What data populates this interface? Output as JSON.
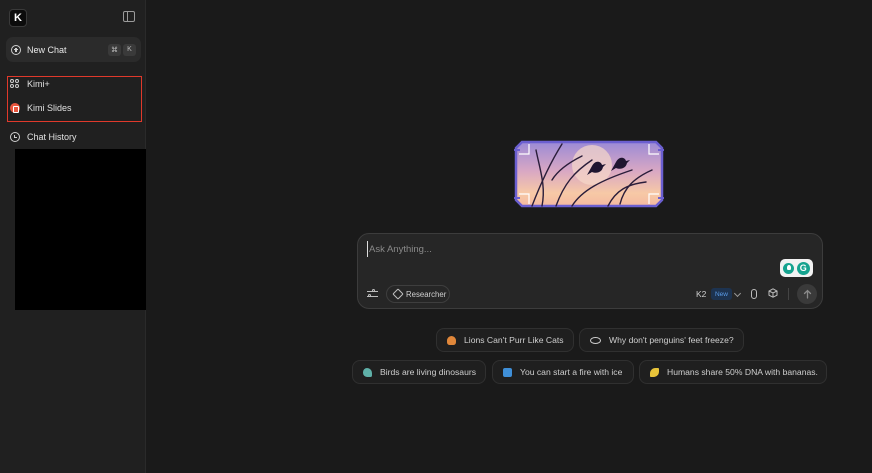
{
  "sidebar": {
    "logo_letter": "K",
    "new_chat": {
      "label": "New Chat",
      "shortcut": [
        "⌘",
        "K"
      ]
    },
    "items": [
      {
        "label": "Kimi+",
        "icon": "kimiplus-icon"
      },
      {
        "label": "Kimi Slides",
        "icon": "slides-icon"
      },
      {
        "label": "Chat History",
        "icon": "clock-icon"
      }
    ]
  },
  "chat": {
    "placeholder": "Ask Anything...",
    "grammarly_letter": "G",
    "researcher_label": "Researcher",
    "model": "K2",
    "model_badge": "New"
  },
  "suggestions": [
    {
      "label": "Lions Can't Purr Like Cats",
      "icon": "burger-emoji-icon"
    },
    {
      "label": "Why don't penguins' feet freeze?",
      "icon": "eye-emoji-icon"
    },
    {
      "label": "Birds are living dinosaurs",
      "icon": "bird-emoji-icon"
    },
    {
      "label": "You can start a fire with ice",
      "icon": "flag-emoji-icon"
    },
    {
      "label": "Humans share 50% DNA with bananas.",
      "icon": "banana-emoji-icon"
    }
  ],
  "colors": {
    "background": "#1a1a1a",
    "sidebar": "#202020",
    "highlight": "#e0392b",
    "accent_blue": "#5a9be8",
    "grammarly": "#15a38f"
  }
}
